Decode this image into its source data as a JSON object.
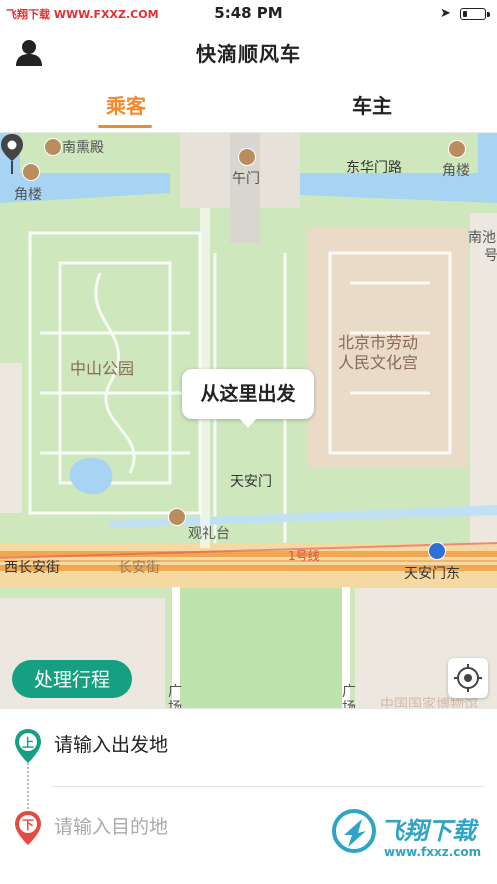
{
  "status_bar": {
    "watermark": "飞翔下载 WWW.FXXZ.COM",
    "time": "5:48 PM",
    "battery_level": 0.2
  },
  "header": {
    "title": "快滴顺风车"
  },
  "tabs": [
    {
      "label": "乘客",
      "active": true
    },
    {
      "label": "车主",
      "active": false
    }
  ],
  "map": {
    "callout": "从这里出发",
    "labels": {
      "nanxundian": "南熏殿",
      "jiaolou_left": "角楼",
      "wumen": "午门",
      "donghuamen_road": "东华门路",
      "jiaolou_right": "角楼",
      "nanchi": "南池",
      "hao": "号",
      "laodong_palace_line1": "北京市劳动",
      "laodong_palace_line2": "人民文化宫",
      "zhongshan_park": "中山公园",
      "tiananmen": "天安门",
      "guanlitai": "观礼台",
      "west_changan": "西长安街",
      "changan_st": "长安街",
      "line1": "1号线",
      "tiananmen_east": "天安门东",
      "guang1": "广",
      "chang1": "场",
      "guang2": "广",
      "chang2": "场",
      "museum": "中国国家博物馆"
    }
  },
  "actions": {
    "process_trip": "处理行程"
  },
  "trip": {
    "start_badge": "上",
    "start_placeholder": "请输入出发地",
    "dest_badge": "下",
    "dest_placeholder": "请输入目的地"
  },
  "brand": {
    "name": "飞翔下载",
    "url": "www.fxxz.com"
  },
  "colors": {
    "accent": "#f08a2c",
    "primary_green": "#16a082",
    "dest_red": "#e44b43"
  }
}
